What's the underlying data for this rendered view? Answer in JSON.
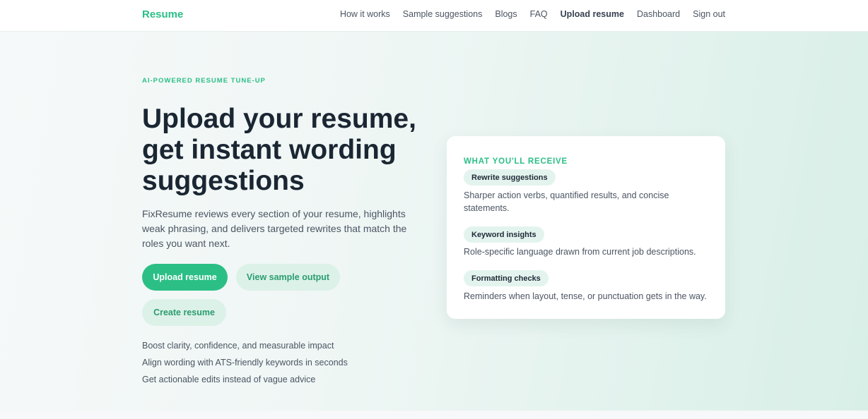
{
  "header": {
    "brand": "Resume",
    "nav": [
      {
        "label": "How it works"
      },
      {
        "label": "Sample suggestions"
      },
      {
        "label": "Blogs"
      },
      {
        "label": "FAQ"
      },
      {
        "label": "Upload resume"
      },
      {
        "label": "Dashboard"
      },
      {
        "label": "Sign out"
      }
    ]
  },
  "hero": {
    "eyebrow": "AI-POWERED RESUME TUNE-UP",
    "title": "Upload your resume, get instant wording suggestions",
    "lead": "FixResume reviews every section of your resume, highlights weak phrasing, and delivers targeted rewrites that match the roles you want next.",
    "buttons": {
      "upload": "Upload resume",
      "sample": "View sample output",
      "create": "Create resume"
    },
    "benefits": [
      "Boost clarity, confidence, and measurable impact",
      "Align wording with ATS-friendly keywords in seconds",
      "Get actionable edits instead of vague advice"
    ]
  },
  "card": {
    "title": "WHAT YOU'LL RECEIVE",
    "items": [
      {
        "chip": "Rewrite suggestions",
        "desc": "Sharper action verbs, quantified results, and concise statements."
      },
      {
        "chip": "Keyword insights",
        "desc": "Role-specific language drawn from current job descriptions."
      },
      {
        "chip": "Formatting checks",
        "desc": "Reminders when layout, tense, or punctuation gets in the way."
      }
    ]
  },
  "colors": {
    "accent": "#2bbf86",
    "chip_bg": "#e3f4ee",
    "text_dark": "#1b2633"
  }
}
